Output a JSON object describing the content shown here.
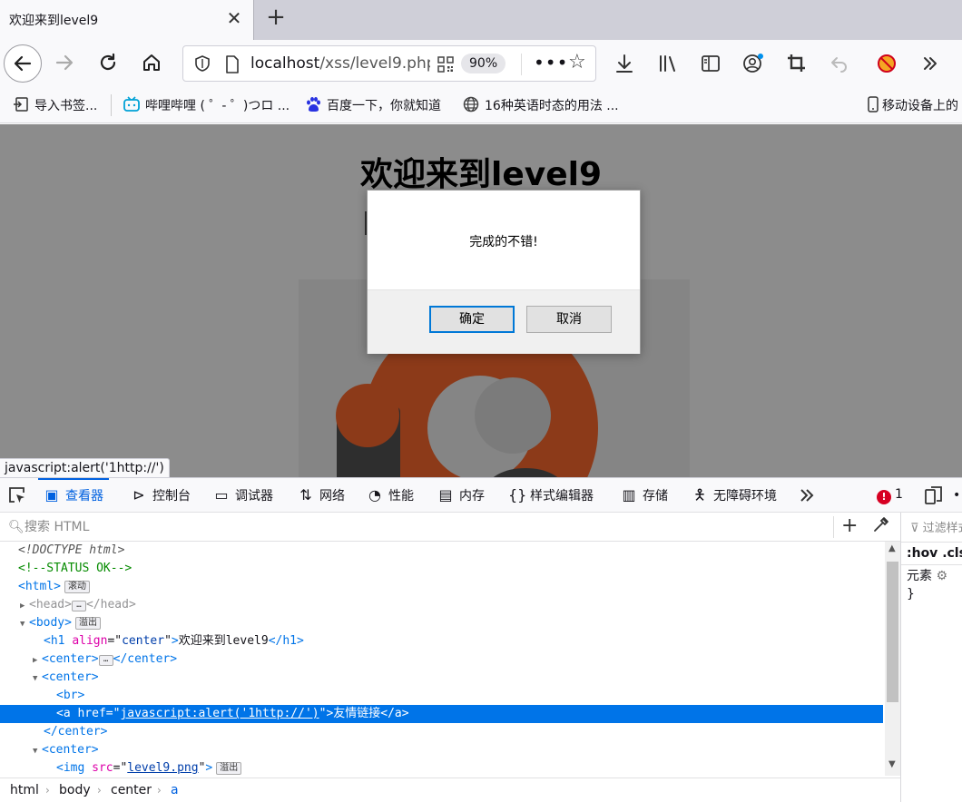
{
  "browser": {
    "tab_title": "欢迎来到level9",
    "close_glyph": "✕",
    "new_tab_glyph": "+",
    "url_host": "localhost",
    "url_path": "/xss/level9.php",
    "zoom": "90%"
  },
  "bookmarks": [
    {
      "label": "导入书签..."
    },
    {
      "label": "哔哩哔哩 ( ゜- ゜)つロ ..."
    },
    {
      "label": "百度一下，你就知道"
    },
    {
      "label": "16种英语时态的用法 ..."
    },
    {
      "label": "移动设备上的"
    }
  ],
  "page": {
    "heading": "欢迎来到level9"
  },
  "dialog": {
    "message": "完成的不错!",
    "ok_label": "确定",
    "cancel_label": "取消"
  },
  "status_link": "javascript:alert('1http://')",
  "devtools": {
    "tabs": [
      "查看器",
      "控制台",
      "调试器",
      "网络",
      "性能",
      "内存",
      "样式编辑器",
      "存储",
      "无障碍环境"
    ],
    "error_count": "1",
    "search_placeholder": "搜索 HTML",
    "markup": {
      "doctype": "<!DOCTYPE html>",
      "comment": "<!--STATUS OK-->",
      "html_tag": "html",
      "scroll_badge": "滚动",
      "head_tag": "head",
      "body_tag": "body",
      "overflow_badge": "溢出",
      "h1_attr_name": "align",
      "h1_attr_value": "center",
      "h1_text": "欢迎来到level9",
      "center_tag": "center",
      "br_tag": "br",
      "a_attr_name": "href",
      "a_attr_value": "javascript:alert('1http://')",
      "a_text": "友情链接",
      "img_attr_name": "src",
      "img_attr_value": "level9.png"
    },
    "breadcrumbs": [
      "html",
      "body",
      "center",
      "a"
    ],
    "side": {
      "filter_placeholder": "过滤样式",
      "hov": ":hov",
      "cls": ".cls",
      "element_rule": "元素",
      "close_brace": "}"
    }
  },
  "colors": {
    "accent": "#0061e0",
    "selection": "#0074e8",
    "error": "#d70022"
  }
}
